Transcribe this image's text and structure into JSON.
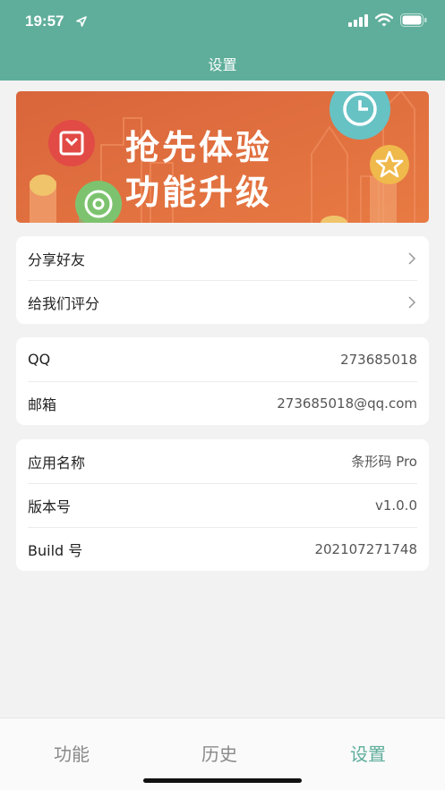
{
  "status_bar": {
    "time": "19:57"
  },
  "nav": {
    "title": "设置"
  },
  "banner": {
    "line1": "抢先体验",
    "line2": "功能升级"
  },
  "group1": {
    "share_label": "分享好友",
    "rate_label": "给我们评分"
  },
  "group2": {
    "qq_label": "QQ",
    "qq_value": "273685018",
    "email_label": "邮箱",
    "email_value": "273685018@qq.com"
  },
  "group3": {
    "app_name_label": "应用名称",
    "app_name_value": "条形码 Pro",
    "version_label": "版本号",
    "version_value": "v1.0.0",
    "build_label": "Build 号",
    "build_value": "202107271748"
  },
  "tabs": [
    {
      "label": "功能",
      "active": false
    },
    {
      "label": "历史",
      "active": false
    },
    {
      "label": "设置",
      "active": true
    }
  ],
  "colors": {
    "accent": "#5fae9b",
    "banner_orange": "#e0693a"
  },
  "icons": [
    "location-arrow-icon",
    "signal-icon",
    "wifi-icon",
    "battery-icon",
    "chevron-right-icon",
    "calendar-icon",
    "clock-icon",
    "star-icon",
    "at-icon"
  ]
}
